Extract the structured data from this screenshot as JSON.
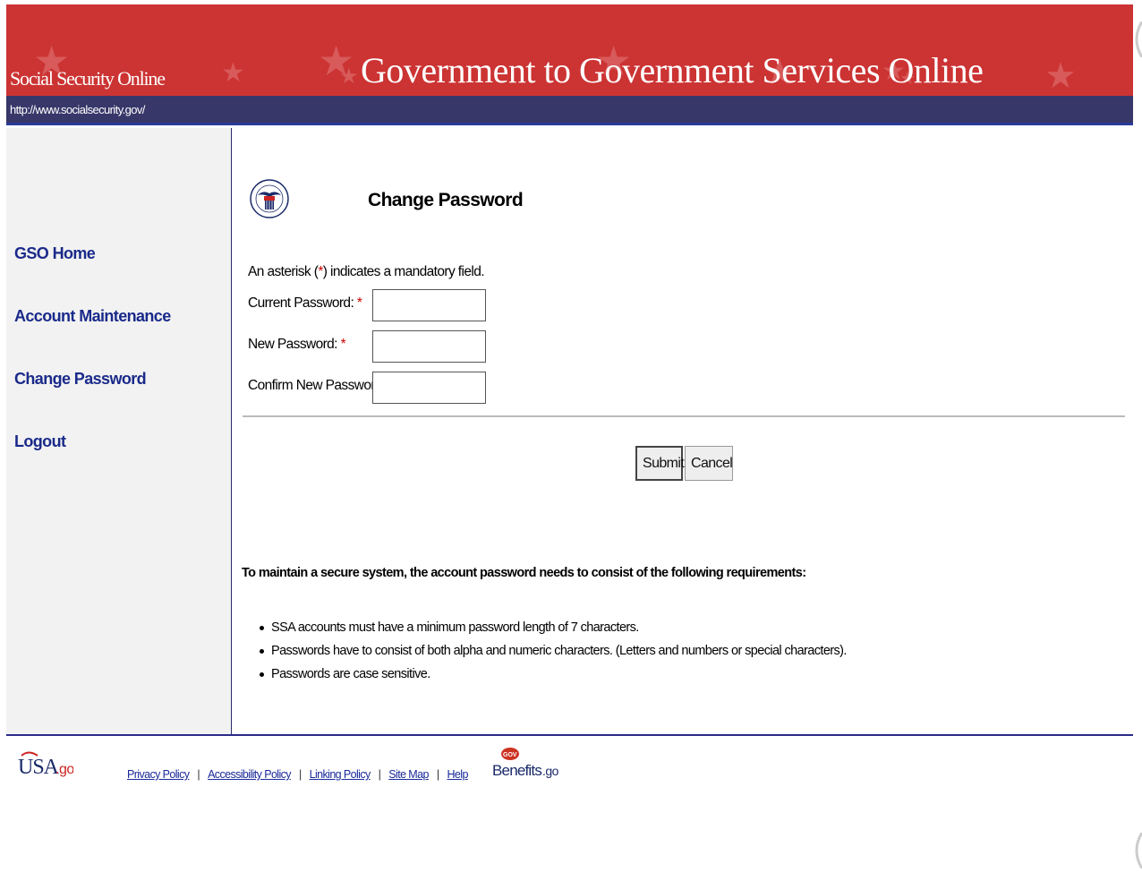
{
  "header": {
    "site_name": "Social Security Online",
    "banner_title": "Government to Government Services Online",
    "url": "http://www.socialsecurity.gov/"
  },
  "sidebar": {
    "items": [
      {
        "label": "GSO Home"
      },
      {
        "label": "Account Maintenance"
      },
      {
        "label": "Change Password"
      },
      {
        "label": "Logout"
      }
    ]
  },
  "main": {
    "seal_text": "SOCIAL SECURITY ADMINISTRATION USA",
    "title": "Change Password",
    "mandatory_note": {
      "before": "An asterisk (",
      "asterisk": "*",
      "after": ") indicates a mandatory field."
    },
    "form": {
      "current_password": {
        "label": "Current Password:",
        "required_mark": "*",
        "value": ""
      },
      "new_password": {
        "label": "New Password:",
        "required_mark": "*",
        "value": ""
      },
      "confirm_password": {
        "label": "Confirm New Password:",
        "required_mark": "*",
        "value": ""
      }
    },
    "buttons": {
      "submit": "Submit",
      "cancel": "Cancel"
    },
    "requirements": {
      "intro": "To maintain a secure system, the account password needs to consist of the following requirements:",
      "items": [
        "SSA accounts must have a minimum password length of 7 characters.",
        "Passwords have to consist of both alpha and numeric characters. (Letters and numbers or special characters).",
        "Passwords are case sensitive."
      ]
    }
  },
  "footer": {
    "usa_logo": "USA.gov",
    "links": [
      "Privacy Policy",
      "Accessibility Policy",
      "Linking Policy",
      "Site Map",
      "Help"
    ],
    "separator": "|",
    "benefits_logo": {
      "badge": "GOV",
      "text": "Benefits.gov"
    }
  },
  "colors": {
    "header_red": "#cc3333",
    "url_bar": "#37376a",
    "nav_link": "#1a2a8a",
    "required": "#cc0000"
  }
}
